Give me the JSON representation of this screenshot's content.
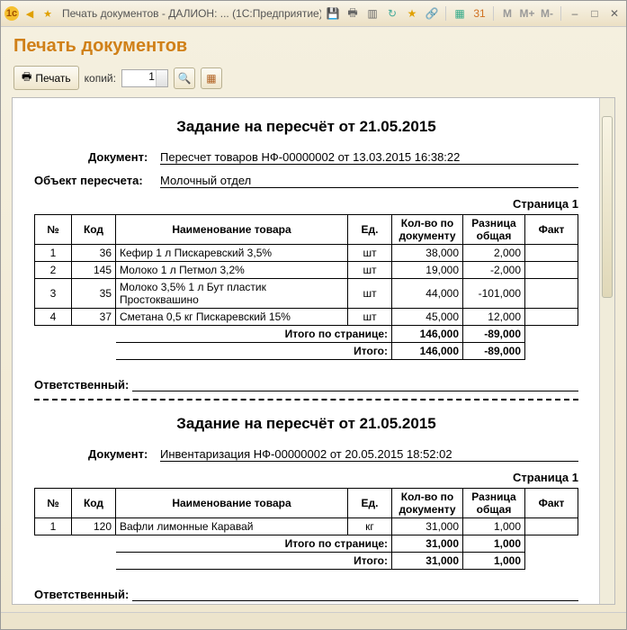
{
  "titlebar": {
    "title": "Печать документов - ДАЛИОН: ...  (1С:Предприятие)",
    "m": "M",
    "mp": "M+",
    "mm": "M-"
  },
  "header": {
    "title": "Печать документов"
  },
  "toolbar": {
    "print": "Печать",
    "copies_label": "копий:",
    "copies_value": "1"
  },
  "doc1": {
    "title": "Задание на пересчёт от 21.05.2015",
    "doc_label": "Документ:",
    "doc_value": "Пересчет товаров НФ-00000002 от 13.03.2015 16:38:22",
    "obj_label": "Объект пересчета:",
    "obj_value": "Молочный отдел",
    "page": "Страница 1",
    "h": {
      "no": "№",
      "code": "Код",
      "name": "Наименование товара",
      "unit": "Ед.",
      "qty": "Кол-во по документу",
      "diff": "Разница общая",
      "fact": "Факт"
    },
    "rows": [
      {
        "no": "1",
        "code": "36",
        "name": "Кефир 1 л  Пискаревский 3,5%",
        "unit": "шт",
        "qty": "38,000",
        "diff": "2,000",
        "fact": ""
      },
      {
        "no": "2",
        "code": "145",
        "name": "Молоко 1 л  Петмол 3,2%",
        "unit": "шт",
        "qty": "19,000",
        "diff": "-2,000",
        "fact": ""
      },
      {
        "no": "3",
        "code": "35",
        "name": "Молоко 3,5% 1 л Бут пластик Простоквашино",
        "unit": "шт",
        "qty": "44,000",
        "diff": "-101,000",
        "fact": ""
      },
      {
        "no": "4",
        "code": "37",
        "name": "Сметана 0,5 кг  Пискаревский 15%",
        "unit": "шт",
        "qty": "45,000",
        "diff": "12,000",
        "fact": ""
      }
    ],
    "sum_page": "Итого по странице:",
    "sum_total": "Итого:",
    "sp_qty": "146,000",
    "sp_diff": "-89,000",
    "st_qty": "146,000",
    "st_diff": "-89,000",
    "resp": "Ответственный:"
  },
  "doc2": {
    "title": "Задание на пересчёт от 21.05.2015",
    "doc_label": "Документ:",
    "doc_value": "Инвентаризация НФ-00000002 от 20.05.2015 18:52:02",
    "page": "Страница 1",
    "h": {
      "no": "№",
      "code": "Код",
      "name": "Наименование товара",
      "unit": "Ед.",
      "qty": "Кол-во по документу",
      "diff": "Разница общая",
      "fact": "Факт"
    },
    "rows": [
      {
        "no": "1",
        "code": "120",
        "name": "Вафли лимонные Каравай",
        "unit": "кг",
        "qty": "31,000",
        "diff": "1,000",
        "fact": ""
      }
    ],
    "sum_page": "Итого по странице:",
    "sum_total": "Итого:",
    "sp_qty": "31,000",
    "sp_diff": "1,000",
    "st_qty": "31,000",
    "st_diff": "1,000",
    "resp": "Ответственный:"
  }
}
